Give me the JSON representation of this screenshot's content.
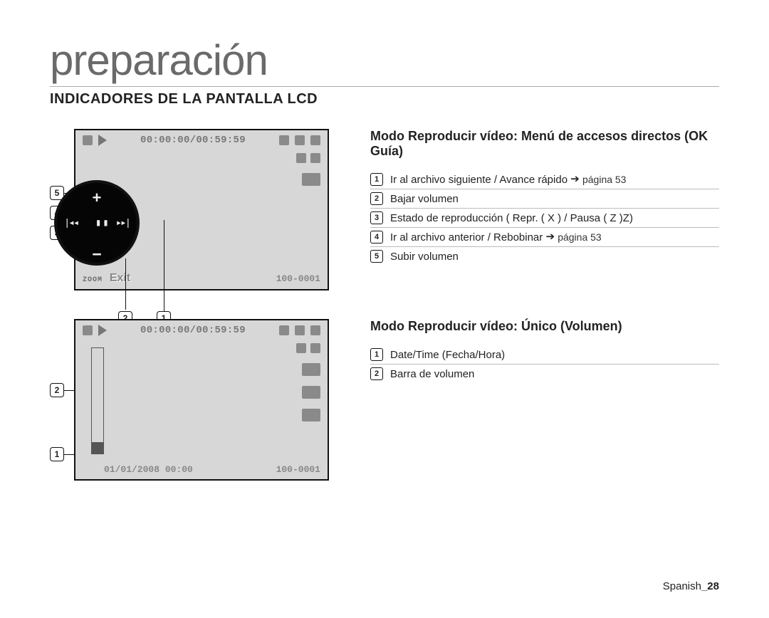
{
  "page": {
    "title": "preparación",
    "subtitle": "INDICADORES DE LA PANTALLA LCD",
    "footer_lang": "Spanish",
    "footer_page": "_28"
  },
  "lcd_common": {
    "time_counter": "00:00:00/00:59:59",
    "file_id": "100-0001",
    "zoom_label": "ZOOM",
    "exit_label": "Exit",
    "datetime": "01/01/2008 00:00"
  },
  "section1": {
    "title": "Modo Reproducir vídeo: Menú de accesos directos (OK Guía)",
    "callouts_left": [
      "5",
      "4",
      "3"
    ],
    "callouts_bottom": [
      "2",
      "1"
    ],
    "items": [
      {
        "n": "1",
        "text": "Ir al archivo siguiente / Avance rápido",
        "page": "página 53"
      },
      {
        "n": "2",
        "text": "Bajar volumen"
      },
      {
        "n": "3",
        "text": "Estado de reproducción ( Repr. (  X ) / Pausa (  Z )Z)"
      },
      {
        "n": "4",
        "text": "Ir al archivo anterior / Rebobinar",
        "page": "página 53"
      },
      {
        "n": "5",
        "text": "Subir volumen"
      }
    ]
  },
  "section2": {
    "title": "Modo Reproducir vídeo: Único (Volumen)",
    "callouts_left": [
      "2",
      "1"
    ],
    "items": [
      {
        "n": "1",
        "text": "Date/Time (Fecha/Hora)"
      },
      {
        "n": "2",
        "text": "Barra de volumen"
      }
    ]
  }
}
